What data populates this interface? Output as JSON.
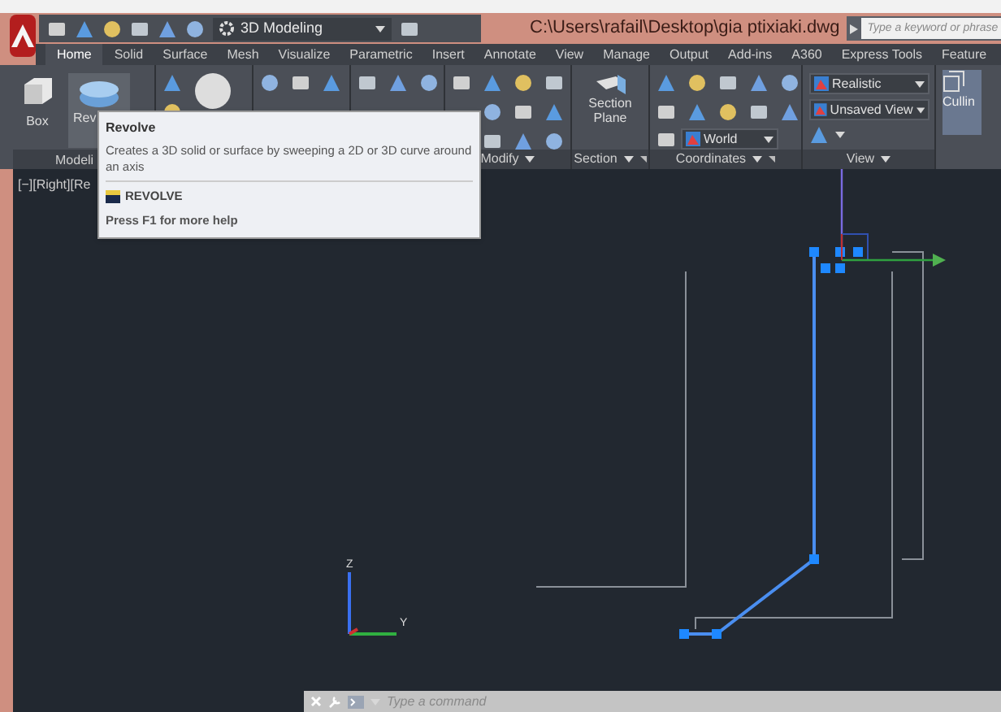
{
  "title": "C:\\Users\\rafail\\Desktop\\gia ptixiaki.dwg",
  "workspace": "3D Modeling",
  "search": {
    "placeholder": "Type a keyword or phrase"
  },
  "tabs": [
    {
      "label": "Home",
      "selected": true
    },
    {
      "label": "Solid",
      "selected": false
    },
    {
      "label": "Surface",
      "selected": false
    },
    {
      "label": "Mesh",
      "selected": false
    },
    {
      "label": "Visualize",
      "selected": false
    },
    {
      "label": "Parametric",
      "selected": false
    },
    {
      "label": "Insert",
      "selected": false
    },
    {
      "label": "Annotate",
      "selected": false
    },
    {
      "label": "View",
      "selected": false
    },
    {
      "label": "Manage",
      "selected": false
    },
    {
      "label": "Output",
      "selected": false
    },
    {
      "label": "Add-ins",
      "selected": false
    },
    {
      "label": "A360",
      "selected": false
    },
    {
      "label": "Express Tools",
      "selected": false
    },
    {
      "label": "Feature",
      "selected": false
    }
  ],
  "ribbon": {
    "modeling": {
      "title": "Modeli",
      "buttons": [
        "Box",
        "Rev"
      ]
    },
    "modify": {
      "title": "Modify"
    },
    "section": {
      "title": "Section",
      "button": "Section Plane"
    },
    "coordinates": {
      "title": "Coordinates",
      "ucs": "World"
    },
    "view": {
      "title": "View",
      "visual_style": "Realistic",
      "named_view": "Unsaved View"
    },
    "culling": {
      "label": "Cullin"
    }
  },
  "tooltip": {
    "title": "Revolve",
    "description": "Creates a 3D solid or surface by sweeping a 2D or 3D curve around an axis",
    "command": "REVOLVE",
    "help": "Press F1 for more help"
  },
  "viewport": {
    "label": "[−][Right][Re",
    "axis_labels": [
      "Z",
      "Y"
    ]
  },
  "command_line": {
    "placeholder": "Type a command"
  }
}
